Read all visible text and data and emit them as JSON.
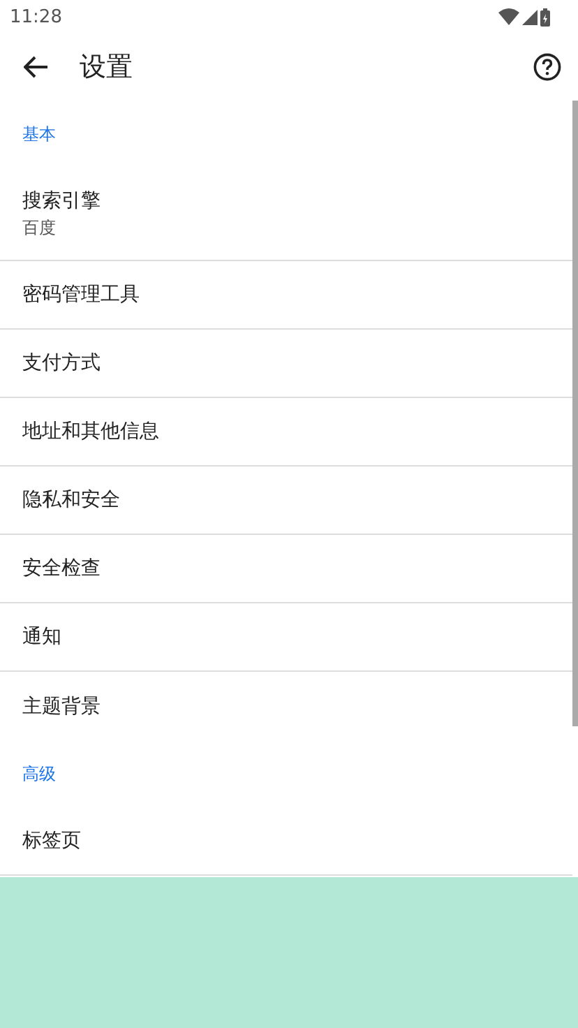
{
  "status_bar": {
    "time": "11:28"
  },
  "toolbar": {
    "title": "设置"
  },
  "sections": [
    {
      "header": "基本",
      "items": [
        {
          "title": "搜索引擎",
          "summary": "百度"
        },
        {
          "title": "密码管理工具"
        },
        {
          "title": "支付方式"
        },
        {
          "title": "地址和其他信息"
        },
        {
          "title": "隐私和安全"
        },
        {
          "title": "安全检查"
        },
        {
          "title": "通知"
        },
        {
          "title": "主题背景"
        }
      ]
    },
    {
      "header": "高级",
      "items": [
        {
          "title": "标签页"
        }
      ]
    }
  ]
}
